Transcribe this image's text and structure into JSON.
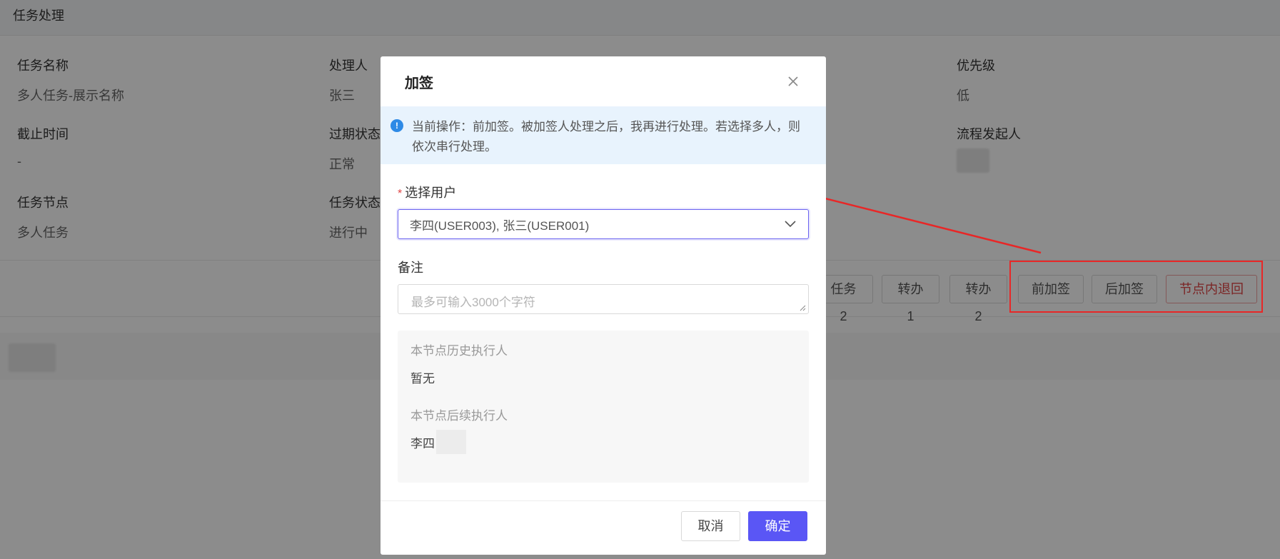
{
  "page": {
    "header_title": "任务处理",
    "fields": [
      {
        "label": "任务名称",
        "value": "多人任务-展示名称"
      },
      {
        "label": "处理人",
        "value": "张三"
      },
      {
        "label": "优先级",
        "value": "低"
      },
      {
        "label": "截止时间",
        "value": "-"
      },
      {
        "label": "过期状态",
        "value": "正常"
      },
      {
        "label": "流程发起人",
        "value": ""
      },
      {
        "label": "任务节点",
        "value": "多人任务"
      },
      {
        "label": "任务状态",
        "value": "进行中"
      }
    ],
    "actions": [
      "任务2",
      "转办1",
      "转办2",
      "前加签",
      "后加签",
      "节点内退回"
    ]
  },
  "dialog": {
    "title": "加签",
    "notice": "当前操作：前加签。被加签人处理之后，我再进行处理。若选择多人，则依次串行处理。",
    "select_label": "选择用户",
    "select_value": "李四(USER003), 张三(USER001)",
    "remark_label": "备注",
    "remark_placeholder": "最多可输入3000个字符",
    "history_label": "本节点历史执行人",
    "history_value": "暂无",
    "next_label": "本节点后续执行人",
    "next_value": "李四",
    "cancel_label": "取消",
    "ok_label": "确定"
  },
  "colors": {
    "primary": "#5a56f5",
    "danger": "#e04545",
    "notice_bg": "#e8f3fd",
    "info_icon": "#2e8ae6",
    "annotation_red": "#e82727"
  }
}
